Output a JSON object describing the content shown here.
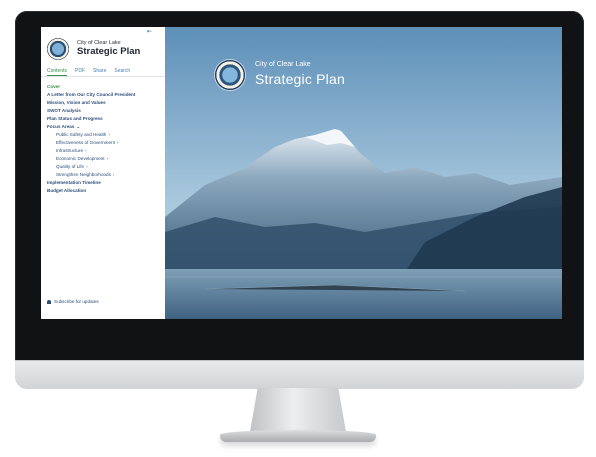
{
  "brand": {
    "city": "City of Clear Lake",
    "title": "Strategic Plan"
  },
  "tabs": [
    {
      "label": "Contents",
      "active": true
    },
    {
      "label": "PDF"
    },
    {
      "label": "Share"
    },
    {
      "label": "Search"
    }
  ],
  "nav": [
    {
      "label": "Cover",
      "active": true
    },
    {
      "label": "A Letter from Our City Council President"
    },
    {
      "label": "Mission, Vision and Values"
    },
    {
      "label": "SWOT Analysis"
    },
    {
      "label": "Plan Status and Progress"
    },
    {
      "label": "Focus Areas",
      "chevron": "⌄"
    },
    {
      "label": "Public Safety and Health",
      "chevron": "›",
      "sub": true
    },
    {
      "label": "Effectiveness of Government",
      "chevron": "›",
      "sub": true
    },
    {
      "label": "Infrastructure",
      "chevron": "›",
      "sub": true
    },
    {
      "label": "Economic Development",
      "chevron": "›",
      "sub": true
    },
    {
      "label": "Quality of Life",
      "chevron": "›",
      "sub": true
    },
    {
      "label": "Strengthen Neighborhoods",
      "chevron": "›",
      "sub": true
    },
    {
      "label": "Implementation Timeline"
    },
    {
      "label": "Budget Allocation"
    }
  ],
  "subscribe": {
    "label": "Subscribe for updates"
  },
  "hero": {
    "city": "City of Clear Lake",
    "title": "Strategic Plan"
  },
  "colors": {
    "accent_green": "#3b8e48",
    "link_blue": "#2d4e7a",
    "sky": "#6e9cc0"
  }
}
